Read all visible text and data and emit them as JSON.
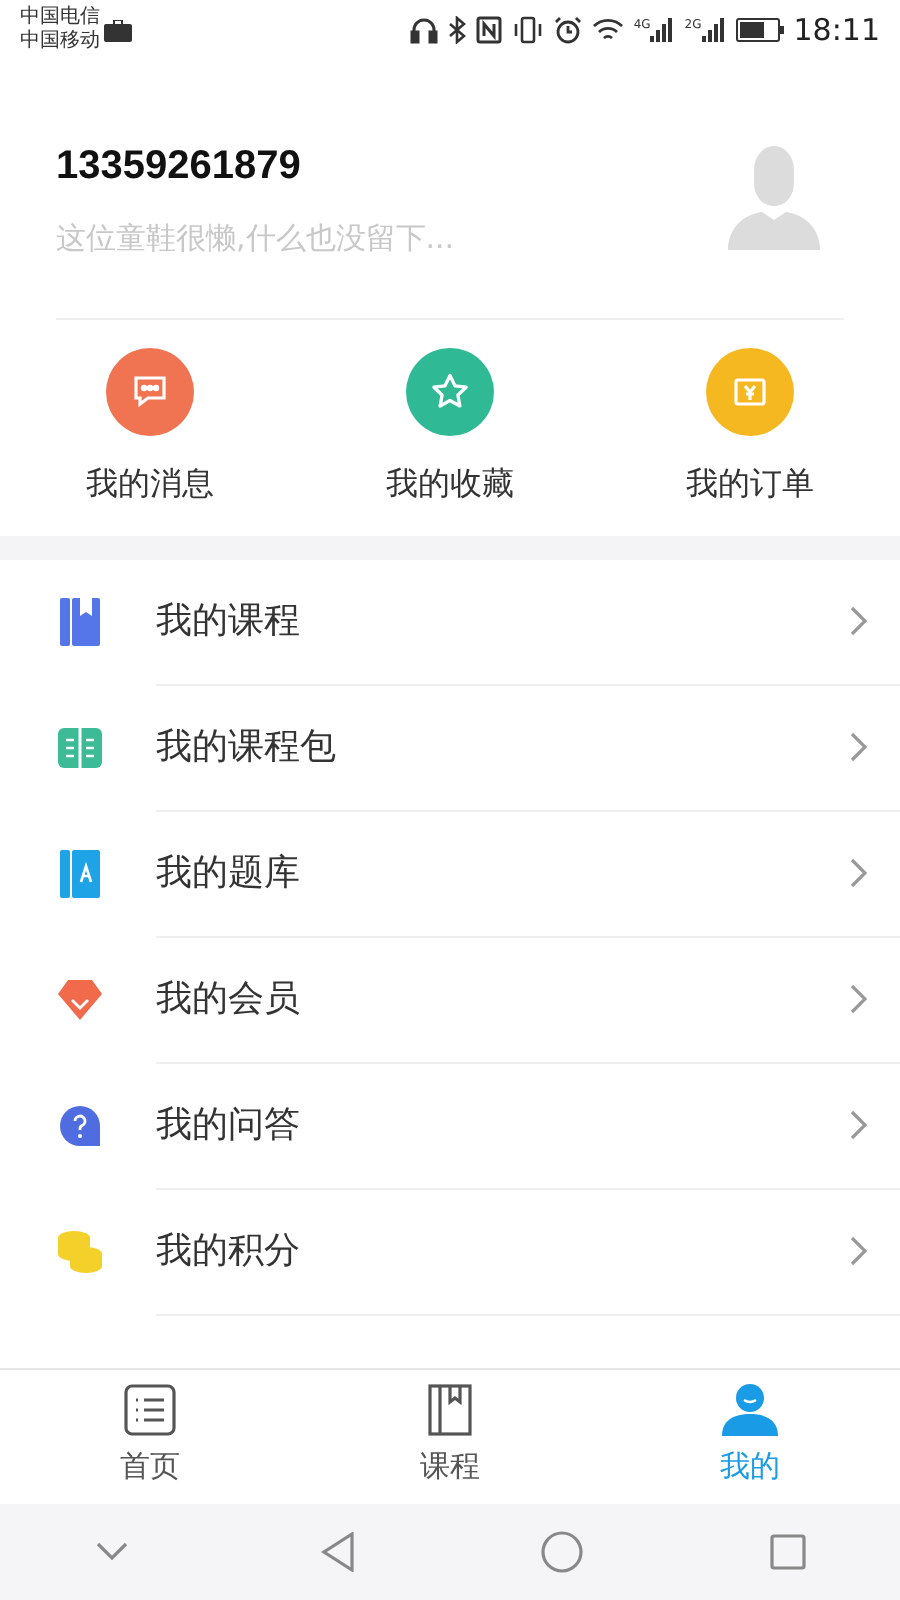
{
  "status_bar": {
    "carriers": [
      "中国电信",
      "中国移动"
    ],
    "network_labels": [
      "4G",
      "2G"
    ],
    "time": "18:11"
  },
  "profile": {
    "phone": "13359261879",
    "bio": "这位童鞋很懒,什么也没留下..."
  },
  "quick_actions": [
    {
      "label": "我的消息",
      "kind": "message",
      "color": "#f07352"
    },
    {
      "label": "我的收藏",
      "kind": "star",
      "color": "#2fba95"
    },
    {
      "label": "我的订单",
      "kind": "order",
      "color": "#f6b820"
    }
  ],
  "menu": [
    {
      "label": "我的课程",
      "kind": "course"
    },
    {
      "label": "我的课程包",
      "kind": "package"
    },
    {
      "label": "我的题库",
      "kind": "bank"
    },
    {
      "label": "我的会员",
      "kind": "member"
    },
    {
      "label": "我的问答",
      "kind": "qa"
    },
    {
      "label": "我的积分",
      "kind": "points"
    }
  ],
  "tabs": [
    {
      "label": "首页",
      "kind": "home",
      "selected": false
    },
    {
      "label": "课程",
      "kind": "course",
      "selected": false
    },
    {
      "label": "我的",
      "kind": "me",
      "selected": true
    }
  ]
}
